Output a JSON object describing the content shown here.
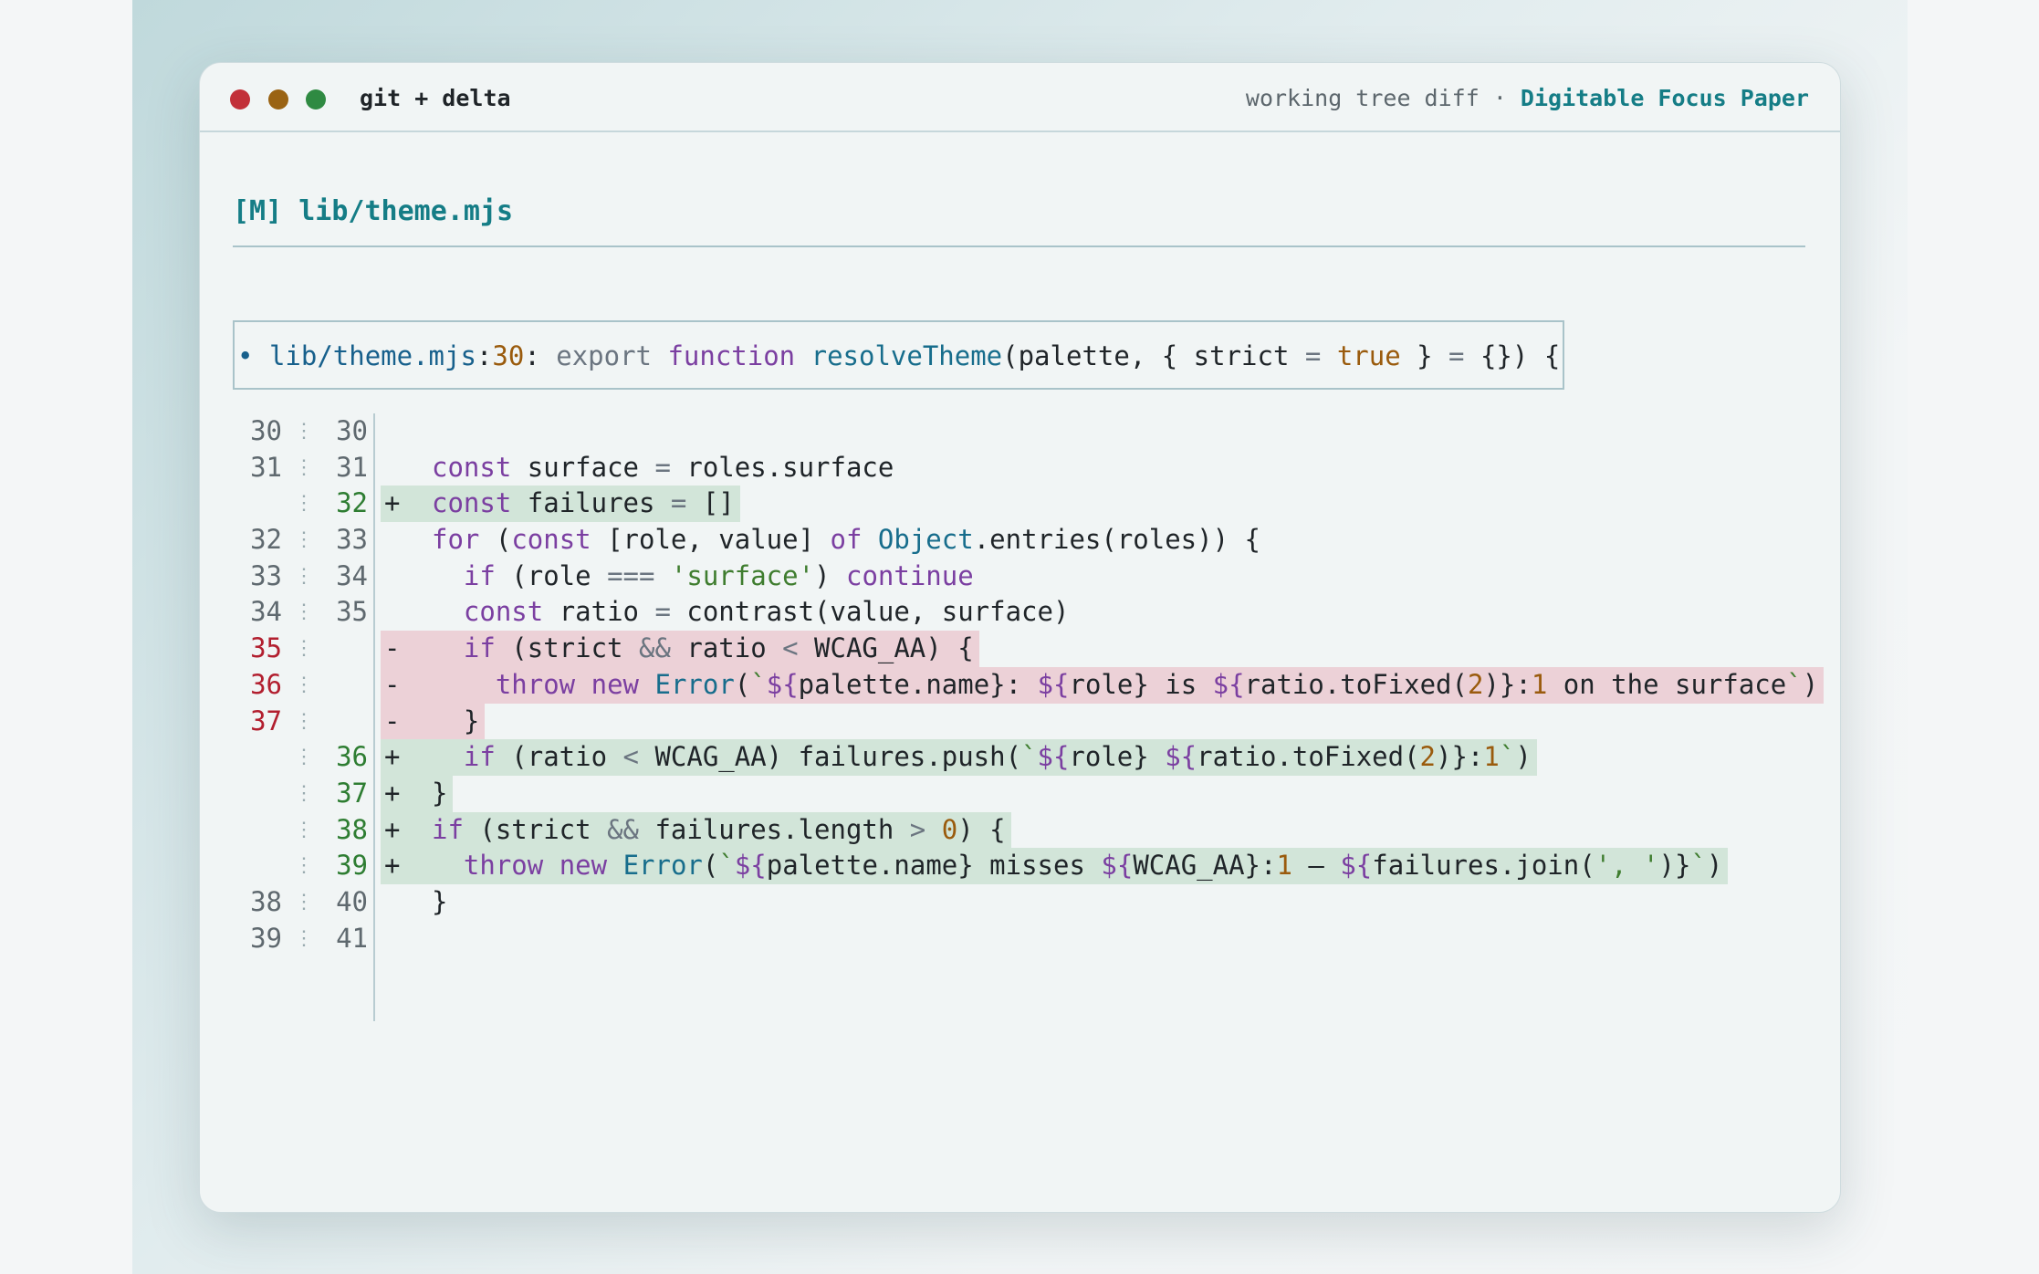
{
  "window": {
    "app_title": "git + delta",
    "subtitle": "working tree diff",
    "separator": " · ",
    "theme_name": "Digitable Focus Paper"
  },
  "file": {
    "status": "[M]",
    "path": "lib/theme.mjs"
  },
  "hunk": {
    "bullet": "•",
    "path": "lib/theme.mjs",
    "line": "30",
    "context_code": "export function resolveTheme(palette, { strict = true } = {}) {"
  },
  "diff": [
    {
      "old": "30",
      "new": "30",
      "type": "context",
      "text": ""
    },
    {
      "old": "31",
      "new": "31",
      "type": "context",
      "text": "const surface = roles.surface"
    },
    {
      "old": "",
      "new": "32",
      "type": "plus",
      "text": "const failures = []"
    },
    {
      "old": "32",
      "new": "33",
      "type": "context",
      "text": "for (const [role, value] of Object.entries(roles)) {"
    },
    {
      "old": "33",
      "new": "34",
      "type": "context",
      "text": "  if (role === 'surface') continue"
    },
    {
      "old": "34",
      "new": "35",
      "type": "context",
      "text": "  const ratio = contrast(value, surface)"
    },
    {
      "old": "35",
      "new": "",
      "type": "minus",
      "text": "  if (strict && ratio < WCAG_AA) {"
    },
    {
      "old": "36",
      "new": "",
      "type": "minus",
      "text": "    throw new Error(`${palette.name}: ${role} is ${ratio.toFixed(2)}:1 on the surface`)"
    },
    {
      "old": "37",
      "new": "",
      "type": "minus",
      "text": "  }"
    },
    {
      "old": "",
      "new": "36",
      "type": "plus",
      "text": "  if (ratio < WCAG_AA) failures.push(`${role} ${ratio.toFixed(2)}:1`)"
    },
    {
      "old": "",
      "new": "37",
      "type": "plus",
      "text": "}"
    },
    {
      "old": "",
      "new": "38",
      "type": "plus",
      "text": "if (strict && failures.length > 0) {"
    },
    {
      "old": "",
      "new": "39",
      "type": "plus",
      "text": "  throw new Error(`${palette.name} misses ${WCAG_AA}:1 — ${failures.join(', ')}`)"
    },
    {
      "old": "38",
      "new": "40",
      "type": "context",
      "text": "}"
    },
    {
      "old": "39",
      "new": "41",
      "type": "context",
      "text": ""
    }
  ],
  "colors": {
    "accent": "#157d86",
    "deleted_line_bg": "#ecd1d7",
    "deleted_word_bg": "#dba8ae",
    "added_line_bg": "#d2e5d9",
    "added_word_bg": "#a8cfb6",
    "traffic_close": "#c23039",
    "traffic_minimize": "#9a6313",
    "traffic_maximize": "#2f8a42"
  }
}
